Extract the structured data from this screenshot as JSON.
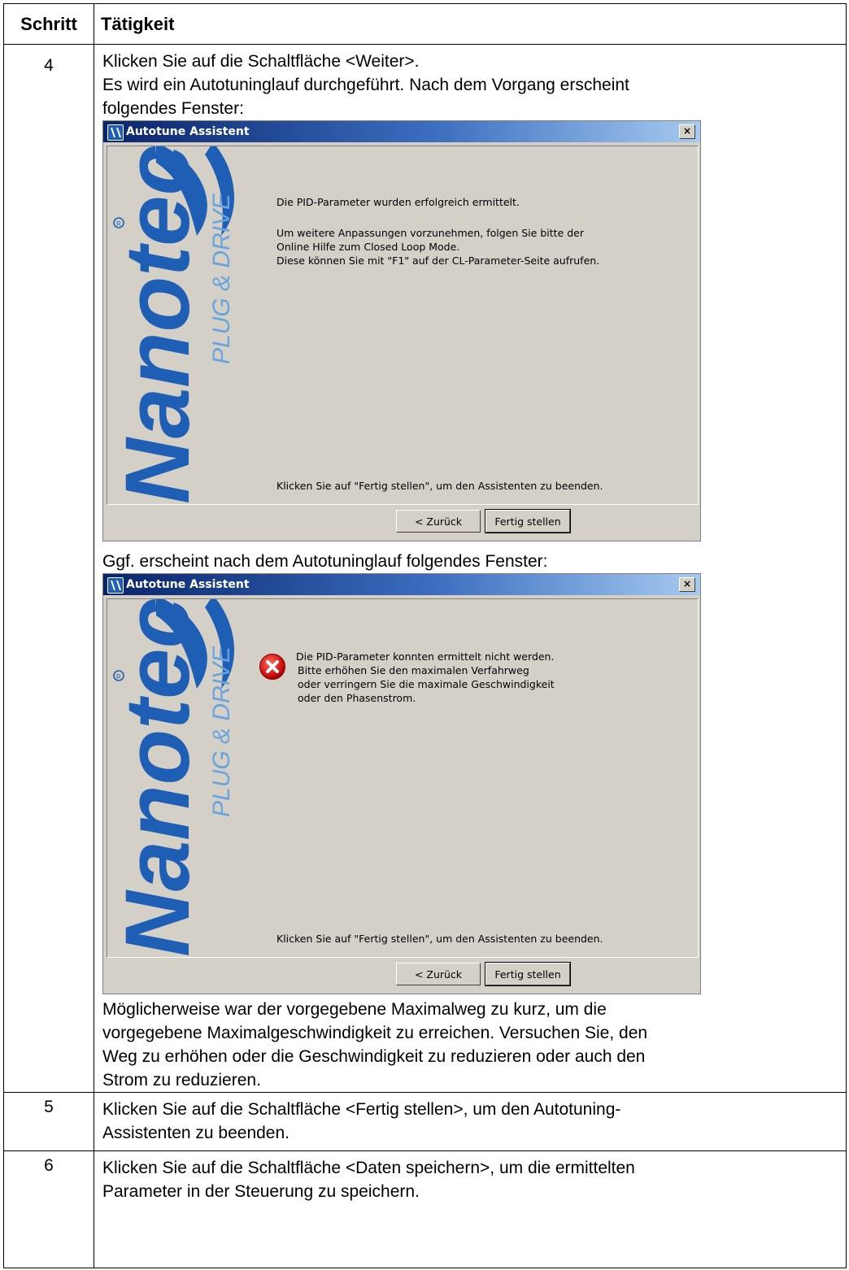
{
  "table": {
    "header_step": "Schritt",
    "header_action": "Tätigkeit"
  },
  "rows": [
    {
      "step": "4",
      "line1": "Klicken Sie auf die Schaltfläche <Weiter>.",
      "line2": "Es wird ein Autotuninglauf durchgeführt. Nach dem Vorgang erscheint",
      "line3": "folgendes Fenster:",
      "between": "Ggf. erscheint nach dem Autotuninglauf folgendes Fenster:",
      "after_1": "Möglicherweise war der vorgegebene Maximalweg zu kurz, um die",
      "after_2": "vorgegebene Maximalgeschwindigkeit zu erreichen. Versuchen Sie, den",
      "after_3": "Weg zu erhöhen oder die Geschwindigkeit zu reduzieren oder auch den",
      "after_4": "Strom zu reduzieren."
    },
    {
      "step": "5",
      "line1": "Klicken Sie auf die Schaltfläche <Fertig stellen>, um den Autotuning-",
      "line2": "Assistenten zu beenden."
    },
    {
      "step": "6",
      "line1": "Klicken Sie auf die Schaltfläche <Daten speichern>, um die ermittelten",
      "line2": "Parameter in der Steuerung zu speichern."
    }
  ],
  "brand": {
    "name": "Nanotec",
    "slogan": "PLUG & DRIVE",
    "color": "#1e5fb5",
    "slogan_color": "#6aa4dc"
  },
  "dialog_success": {
    "title": "Autotune Assistent",
    "close_glyph": "×",
    "msg1": "Die PID-Parameter wurden erfolgreich ermittelt.",
    "msg2": "Um weitere Anpassungen vorzunehmen, folgen Sie bitte der",
    "msg3": "Online Hilfe zum Closed Loop Mode.",
    "msg4": "Diese können Sie mit \"F1\" auf der CL-Parameter-Seite aufrufen.",
    "footer": "Klicken Sie auf \"Fertig stellen\", um den Assistenten zu beenden.",
    "back_button": "< Zurück",
    "finish_button": "Fertig stellen"
  },
  "dialog_error": {
    "title": "Autotune Assistent",
    "close_glyph": "×",
    "icon": "error-icon",
    "msg1": "Die PID-Parameter konnten ermittelt nicht werden.",
    "msg2": "Bitte erhöhen Sie den maximalen Verfahrweg",
    "msg3": "oder verringern Sie die maximale Geschwindigkeit",
    "msg4": "oder den Phasenstrom.",
    "footer": "Klicken Sie auf \"Fertig stellen\", um den Assistenten zu beenden.",
    "back_button": "< Zurück",
    "finish_button": "Fertig stellen"
  }
}
